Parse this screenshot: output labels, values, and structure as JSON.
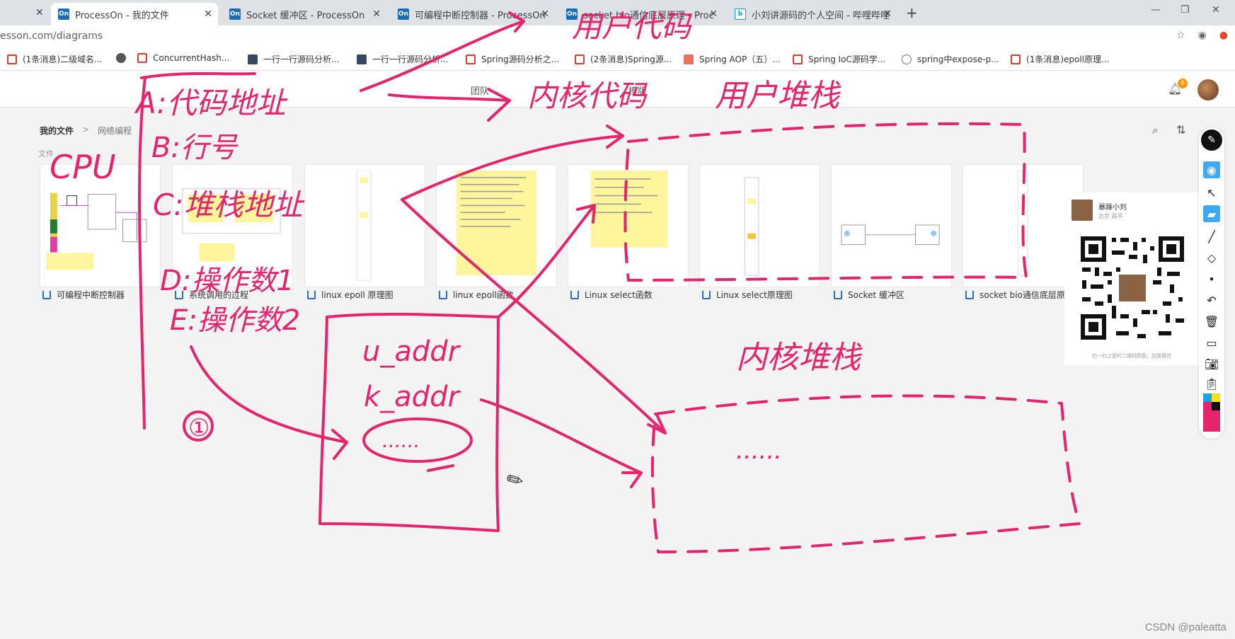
{
  "browser": {
    "tabs": [
      {
        "title": "ProcessOn - 我的文件",
        "favicon": "On",
        "active": true
      },
      {
        "title": "Socket 缓冲区 - ProcessOn",
        "favicon": "On"
      },
      {
        "title": "可编程中断控制器 - ProcessOn",
        "favicon": "On"
      },
      {
        "title": "socket bio通信底层原理 - Proc",
        "favicon": "On"
      },
      {
        "title": "小刘讲源码的个人空间 - 哔哩哔哩",
        "favicon": "bilibili"
      }
    ],
    "new_tab": "+",
    "address": "esson.com/diagrams",
    "bookmarks": [
      {
        "label": "(1条消息)二级域名...",
        "icon": "csdn"
      },
      {
        "label": "",
        "icon": "globe"
      },
      {
        "label": "ConcurrentHash...",
        "icon": "csdn"
      },
      {
        "label": "一行一行源码分析...",
        "icon": "code"
      },
      {
        "label": "一行一行源码分析...",
        "icon": "code"
      },
      {
        "label": "Spring源码分析之...",
        "icon": "csdn"
      },
      {
        "label": "(2条消息)Spring源...",
        "icon": "csdn"
      },
      {
        "label": "Spring AOP（五）...",
        "icon": "jian"
      },
      {
        "label": "Spring IoC源码学...",
        "icon": "csdn"
      },
      {
        "label": "spring中expose-p...",
        "icon": "leaf"
      },
      {
        "label": "(1条消息)epoll原理...",
        "icon": "csdn"
      }
    ]
  },
  "processon": {
    "nav": {
      "team": "团队",
      "templates": "模版"
    },
    "notification_count": "6",
    "breadcrumb": {
      "root": "我的文件",
      "separator": ">",
      "current": "网络编程"
    },
    "section_label": "文件",
    "files": [
      {
        "name": "可编程中断控制器"
      },
      {
        "name": "系统调用的过程"
      },
      {
        "name": "linux epoll 原理图"
      },
      {
        "name": "linux epoll函数"
      },
      {
        "name": "Linux select函数"
      },
      {
        "name": "Linux select原理图"
      },
      {
        "name": "Socket 缓冲区"
      },
      {
        "name": "socket bio通信底层原理"
      }
    ],
    "profile": {
      "name": "暴躁小刘",
      "location": "北京 昌平",
      "footer": "扫一扫上面的二维码图案，加我微信"
    }
  },
  "annotations": {
    "user_code": "用户代码",
    "kernel_code": "内核代码",
    "user_stack": "用户堆栈",
    "kernel_stack": "内核堆栈",
    "cpu": "CPU",
    "a": "A:代码地址",
    "b": "B:行号",
    "c": "C:堆栈地址",
    "d": "D:操作数1",
    "e": "E:操作数2",
    "circle_1": "①",
    "u_addr": "u_addr",
    "k_addr": "k_addr",
    "dots": "......"
  },
  "colors": {
    "annotation": "#e6246e",
    "processon_blue": "#1b6cb4",
    "accent_blue": "#3fa9f5"
  },
  "watermark": "CSDN @paleatta"
}
